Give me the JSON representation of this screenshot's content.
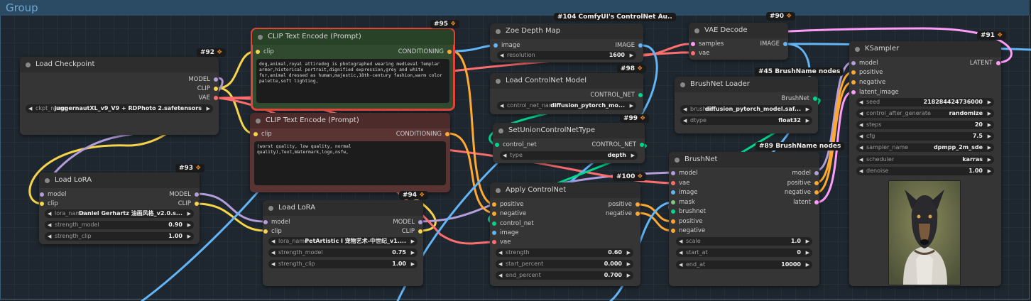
{
  "group": {
    "title": "Group"
  },
  "colors": {
    "clip": "#f7d54a",
    "model": "#b39ddb",
    "vae": "#ff6e6e",
    "conditioning": "#ffa931",
    "image": "#64b5f6",
    "latent": "#ff9cf9",
    "control_net": "#00d78d"
  },
  "nodes": {
    "load_checkpoint": {
      "title": "Load Checkpoint",
      "id": "#92",
      "outputs": [
        "MODEL",
        "CLIP",
        "VAE"
      ],
      "widget_label": "ckpt_name",
      "widget_value": "juggernautXL_v9_V9 + RDPhoto 2.safetensors"
    },
    "clip_pos": {
      "title": "CLIP Text Encode (Prompt)",
      "id": "#95",
      "input": "clip",
      "output": "CONDITIONING",
      "text": "dog,animal,royal attiredog is photographed wearing medieval Templar armor,historical portrait,dignified expression,grey and white fur,animal dressed as human,majestic,18th-century fashion,warm color palette,soft lighting,"
    },
    "clip_neg": {
      "title": "CLIP Text Encode (Prompt)",
      "input": "clip",
      "output": "CONDITIONING",
      "text": "(worst quality, low quality, normal quality),Text,Watermark,logo,nsfw,"
    },
    "lora1": {
      "title": "Load LoRA",
      "id": "#93",
      "inputs": [
        "model",
        "clip"
      ],
      "outputs": [
        "MODEL",
        "CLIP"
      ],
      "widgets": [
        {
          "label": "lora_name",
          "value": "Daniel Gerhartz 油画风格_v2.0.s..."
        },
        {
          "label": "strength_model",
          "value": "0.90"
        },
        {
          "label": "strength_clip",
          "value": "1.00"
        }
      ]
    },
    "lora2": {
      "title": "Load LoRA",
      "id": "#94",
      "inputs": [
        "model",
        "clip"
      ],
      "outputs": [
        "MODEL",
        "CLIP"
      ],
      "widgets": [
        {
          "label": "lora_name",
          "value": "PetArtistic I 宠物艺术-中世纪_v1...."
        },
        {
          "label": "strength_model",
          "value": "0.75"
        },
        {
          "label": "strength_clip",
          "value": "1.00"
        }
      ]
    },
    "zoe": {
      "title": "Zoe Depth Map",
      "id": "#104 ComfyUI's ControlNet Au..",
      "input": "image",
      "output": "IMAGE",
      "widget_label": "resolution",
      "widget_value": "1600"
    },
    "cn_loader": {
      "title": "Load ControlNet Model",
      "id": "#98",
      "output": "CONTROL_NET",
      "widget_label": "control_net_name",
      "widget_value": "diffusion_pytorch_mo..."
    },
    "union": {
      "title": "SetUnionControlNetType",
      "id": "#99",
      "input": "control_net",
      "output": "CONTROL_NET",
      "widget_label": "type",
      "widget_value": "depth"
    },
    "apply_cn": {
      "title": "Apply ControlNet",
      "id": "#100",
      "inputs": [
        "positive",
        "negative",
        "control_net",
        "image",
        "vae"
      ],
      "outputs": [
        "positive",
        "negative"
      ],
      "widgets": [
        {
          "label": "strength",
          "value": "0.60"
        },
        {
          "label": "start_percent",
          "value": "0.000"
        },
        {
          "label": "end_percent",
          "value": "0.700"
        }
      ]
    },
    "vae_decode": {
      "title": "VAE Decode",
      "id": "#90",
      "inputs": [
        "samples",
        "vae"
      ],
      "output": "IMAGE"
    },
    "bn_loader": {
      "title": "BrushNet Loader",
      "id": "#45 BrushName nodes",
      "output": "BrushNet",
      "widgets": [
        {
          "label": "brushnet",
          "value": "diffusion_pytorch_model.saf..."
        },
        {
          "label": "dtype",
          "value": "float32"
        }
      ]
    },
    "brushnet": {
      "title": "BrushNet",
      "id": "#89 BrushName nodes",
      "inputs": [
        "model",
        "vae",
        "image",
        "mask",
        "brushnet",
        "positive",
        "negative"
      ],
      "outputs": [
        "model",
        "positive",
        "negative",
        "latent"
      ],
      "widgets": [
        {
          "label": "scale",
          "value": "1.0"
        },
        {
          "label": "start_at",
          "value": "0"
        },
        {
          "label": "end_at",
          "value": "10000"
        }
      ]
    },
    "ksampler": {
      "title": "KSampler",
      "id": "#91",
      "inputs": [
        "model",
        "positive",
        "negative",
        "latent_image"
      ],
      "output": "LATENT",
      "widgets": [
        {
          "label": "seed",
          "value": "218284424736000"
        },
        {
          "label": "control_after_generate",
          "value": "randomize"
        },
        {
          "label": "steps",
          "value": "20"
        },
        {
          "label": "cfg",
          "value": "7.5"
        },
        {
          "label": "sampler_name",
          "value": "dpmpp_2m_sde"
        },
        {
          "label": "scheduler",
          "value": "karras"
        },
        {
          "label": "denoise",
          "value": "1.00"
        }
      ]
    }
  }
}
